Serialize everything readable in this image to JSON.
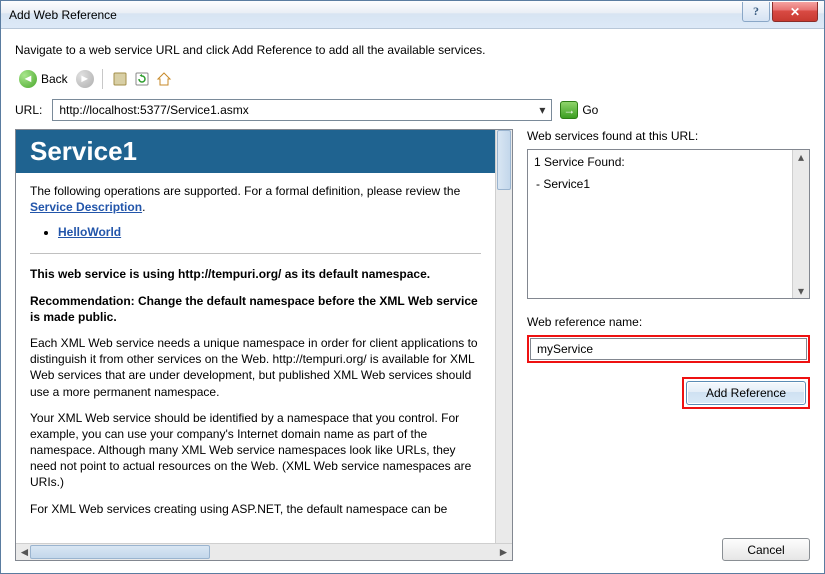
{
  "title": "Add Web Reference",
  "instruction": "Navigate to a web service URL and click Add Reference to add all the available services.",
  "toolbar": {
    "back": "Back"
  },
  "url": {
    "label": "URL:",
    "value": "http://localhost:5377/Service1.asmx",
    "go": "Go"
  },
  "doc": {
    "header": "Service1",
    "intro_a": "The following operations are supported. For a formal definition, please review the ",
    "intro_link": "Service Description",
    "intro_b": ".",
    "operations": [
      "HelloWorld"
    ],
    "ns_line": "This web service is using http://tempuri.org/ as its default namespace.",
    "rec_line": "Recommendation: Change the default namespace before the XML Web service is made public.",
    "para1": "Each XML Web service needs a unique namespace in order for client applications to distinguish it from other services on the Web. http://tempuri.org/ is available for XML Web services that are under development, but published XML Web services should use a more permanent namespace.",
    "para2": "Your XML Web service should be identified by a namespace that you control. For example, you can use your company's Internet domain name as part of the namespace. Although many XML Web service namespaces look like URLs, they need not point to actual resources on the Web. (XML Web service namespaces are URIs.)",
    "para3": "For XML Web services creating using ASP.NET, the default namespace can be"
  },
  "found": {
    "label": "Web services found at this URL:",
    "summary": "1 Service Found:",
    "items": [
      "- Service1"
    ]
  },
  "refname": {
    "label": "Web reference name:",
    "value": "myService"
  },
  "buttons": {
    "add": "Add Reference",
    "cancel": "Cancel"
  },
  "titlebar": {
    "help": "?",
    "close": "✕"
  }
}
